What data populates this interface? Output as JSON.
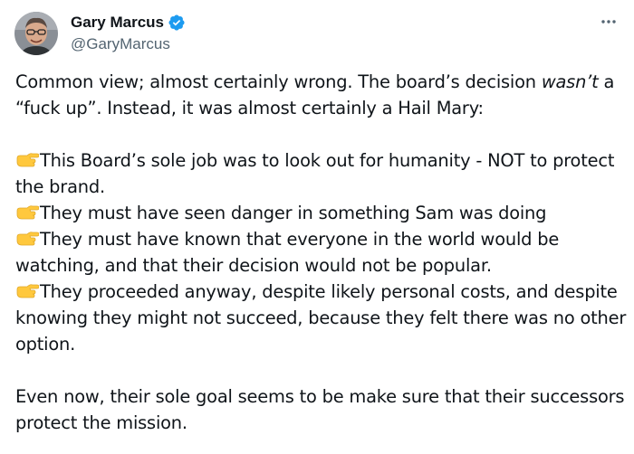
{
  "author": {
    "display_name": "Gary Marcus",
    "handle": "@GaryMarcus",
    "verified": true,
    "verified_color": "#1d9bf0"
  },
  "icons": {
    "verified": "verified-badge-icon",
    "more": "more-options-icon",
    "bullet": "backhand-index-pointing-right-emoji"
  },
  "tweet": {
    "intro_1": "Common view; almost certainly wrong. The board’s decision ",
    "intro_italic": "wasn’t",
    "intro_2": " a",
    "intro_line2": "“fuck up”. Instead, it was almost certainly a Hail Mary:",
    "bullets": [
      "This Board’s sole job was to look out for humanity - NOT to protect the brand.",
      "They must have seen danger in something Sam was doing",
      "They must have known that everyone in the world would be watching, and that their decision would not be popular.",
      "They proceeded anyway, despite likely personal costs, and despite knowing they might not succeed, because they felt there was no other option."
    ],
    "closing": "Even now, their sole goal seems to be make sure that their successors protect the mission."
  }
}
